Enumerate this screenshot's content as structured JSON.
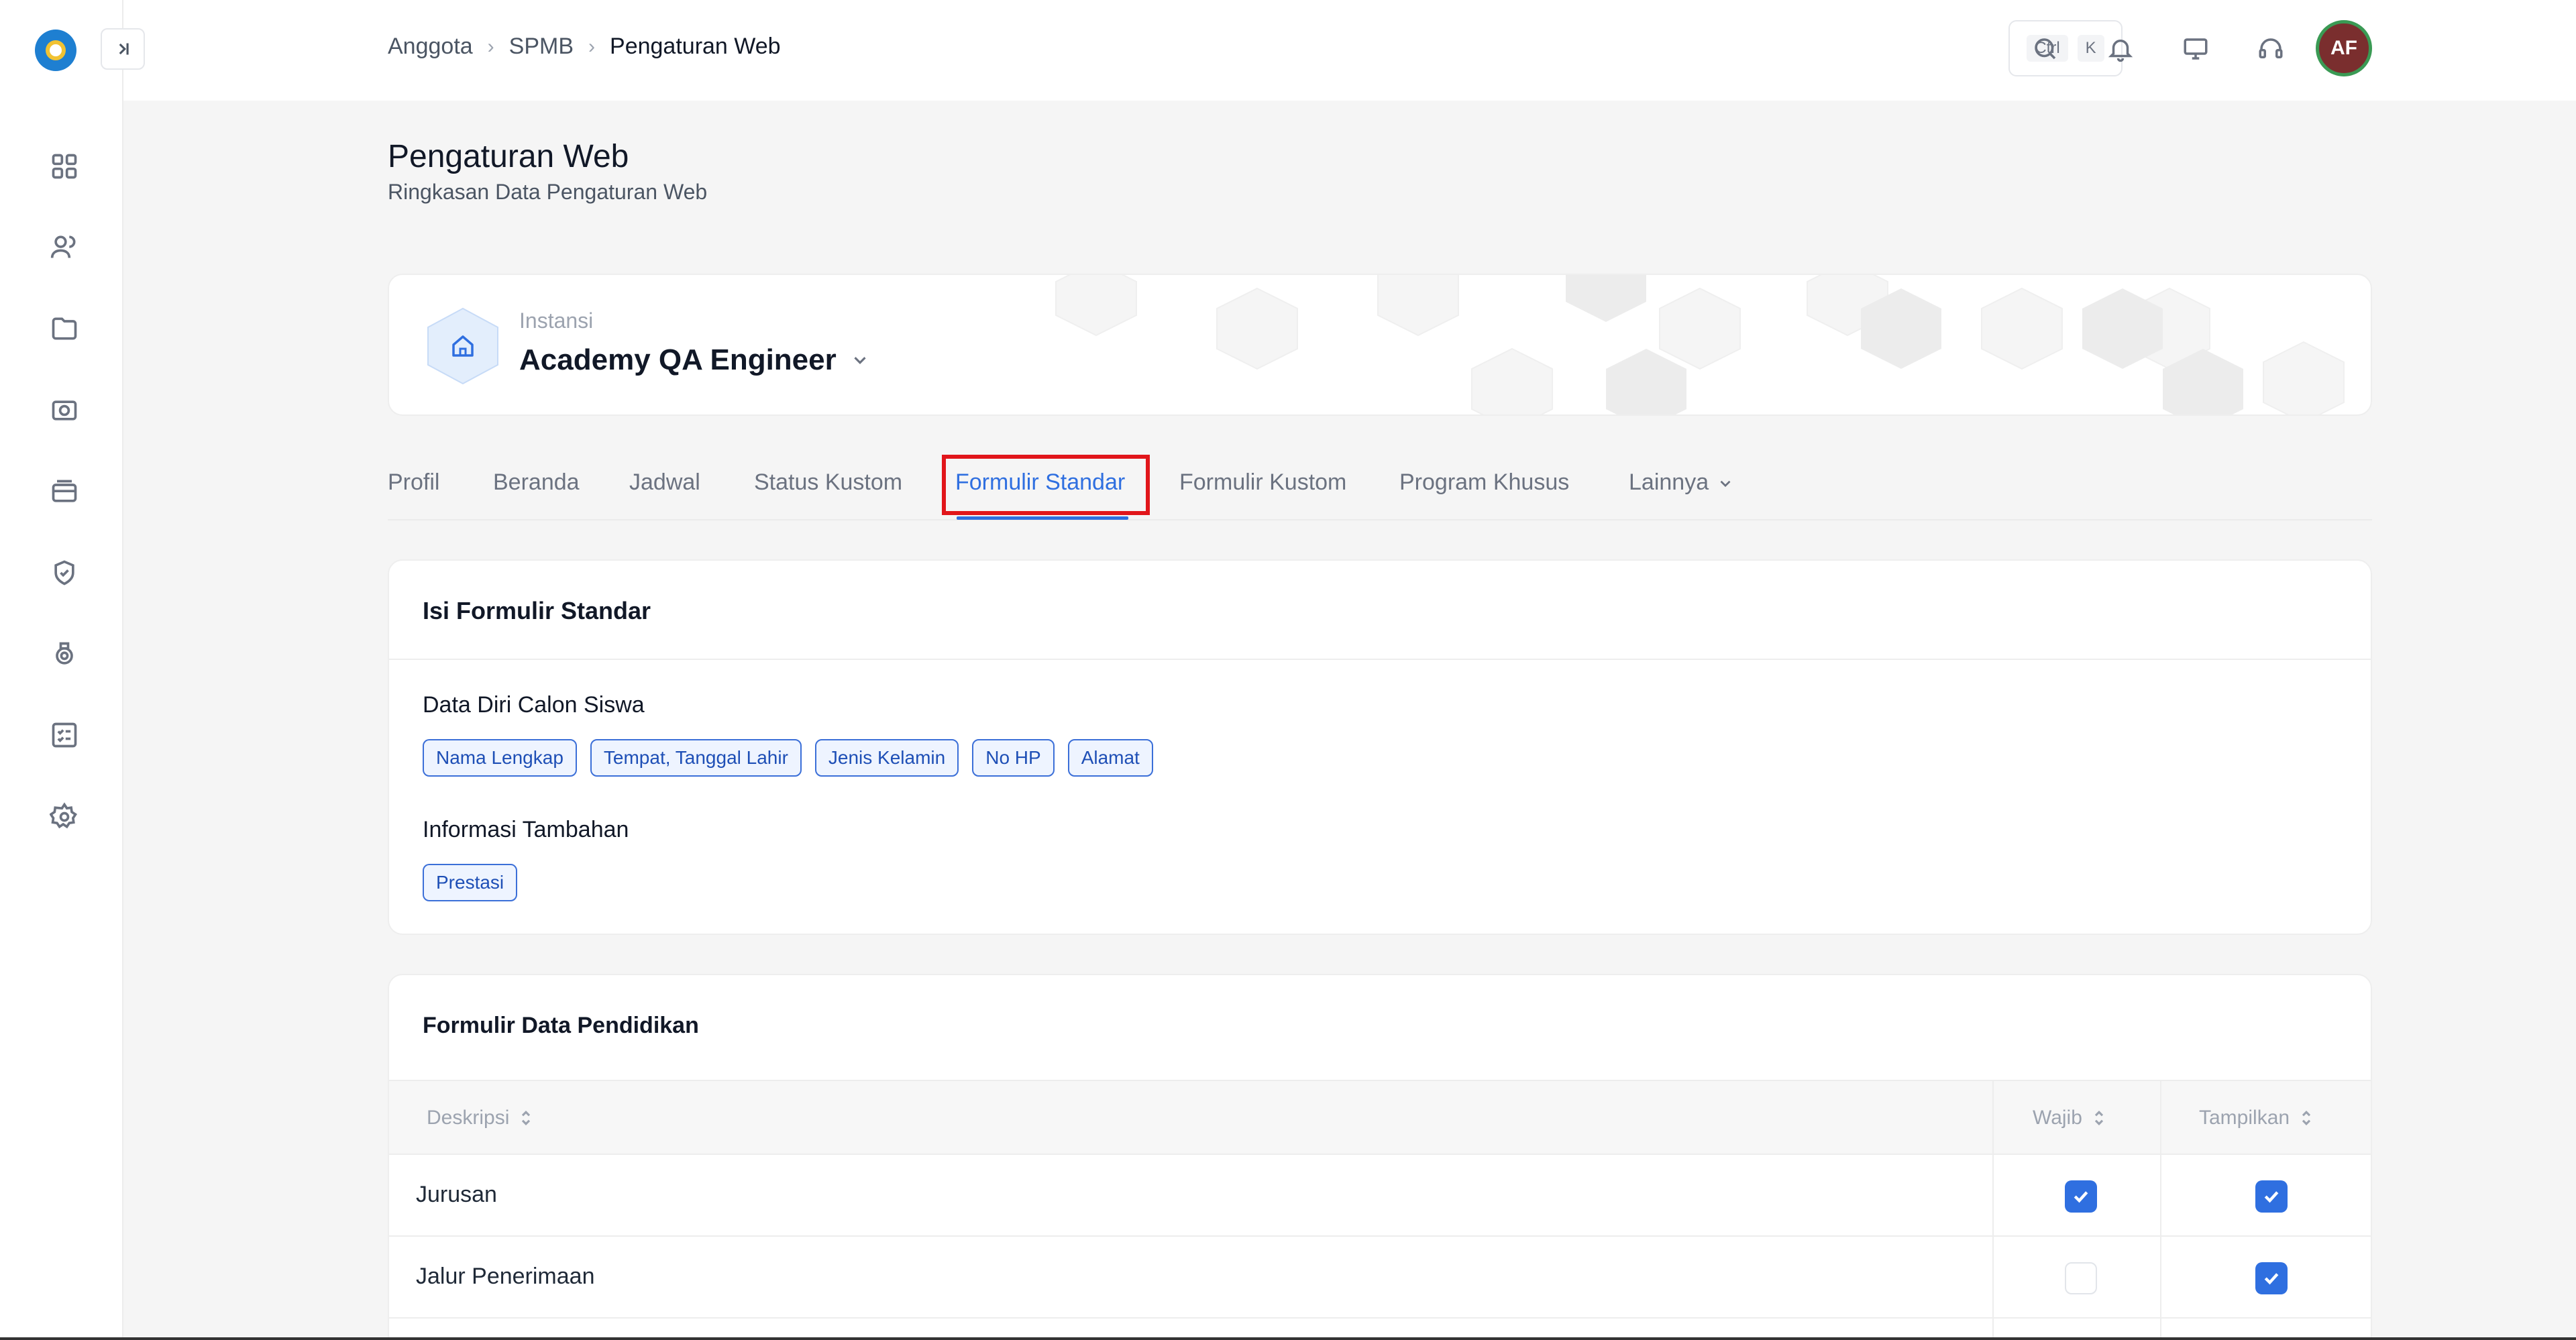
{
  "breadcrumb": {
    "items": [
      "Anggota",
      "SPMB",
      "Pengaturan Web"
    ]
  },
  "shortcut": {
    "key1": "Ctrl",
    "key2": "K"
  },
  "user": {
    "initials": "AF"
  },
  "page": {
    "title": "Pengaturan Web",
    "subtitle": "Ringkasan Data Pengaturan Web"
  },
  "instance": {
    "label": "Instansi",
    "name": "Academy QA Engineer"
  },
  "tabs": [
    {
      "label": "Profil"
    },
    {
      "label": "Beranda"
    },
    {
      "label": "Jadwal"
    },
    {
      "label": "Status Kustom"
    },
    {
      "label": "Formulir Standar",
      "active": true
    },
    {
      "label": "Formulir Kustom"
    },
    {
      "label": "Program Khusus"
    },
    {
      "label": "Lainnya"
    }
  ],
  "form_card": {
    "title": "Isi Formulir Standar",
    "groups": [
      {
        "label": "Data Diri Calon Siswa",
        "chips": [
          "Nama Lengkap",
          "Tempat, Tanggal Lahir",
          "Jenis Kelamin",
          "No HP",
          "Alamat"
        ]
      },
      {
        "label": "Informasi Tambahan",
        "chips": [
          "Prestasi"
        ]
      }
    ]
  },
  "edu_card": {
    "title": "Formulir Data Pendidikan",
    "columns": {
      "desc": "Deskripsi",
      "required": "Wajib",
      "show": "Tampilkan"
    },
    "rows": [
      {
        "label": "Jurusan",
        "required": true,
        "show": true
      },
      {
        "label": "Jalur Penerimaan",
        "required": false,
        "show": true
      }
    ]
  },
  "colors": {
    "accent": "#2f6fe0",
    "highlight": "#e1161b",
    "avatar_bg": "#7a2e2e"
  },
  "icons": {
    "sidebar": [
      "dashboard-icon",
      "users-icon",
      "folder-icon",
      "camera-icon",
      "card-icon",
      "badge-icon",
      "award-icon",
      "checklist-icon",
      "settings-icon"
    ],
    "topbar": [
      "search-icon",
      "bell-icon",
      "monitor-icon",
      "headset-icon"
    ]
  }
}
